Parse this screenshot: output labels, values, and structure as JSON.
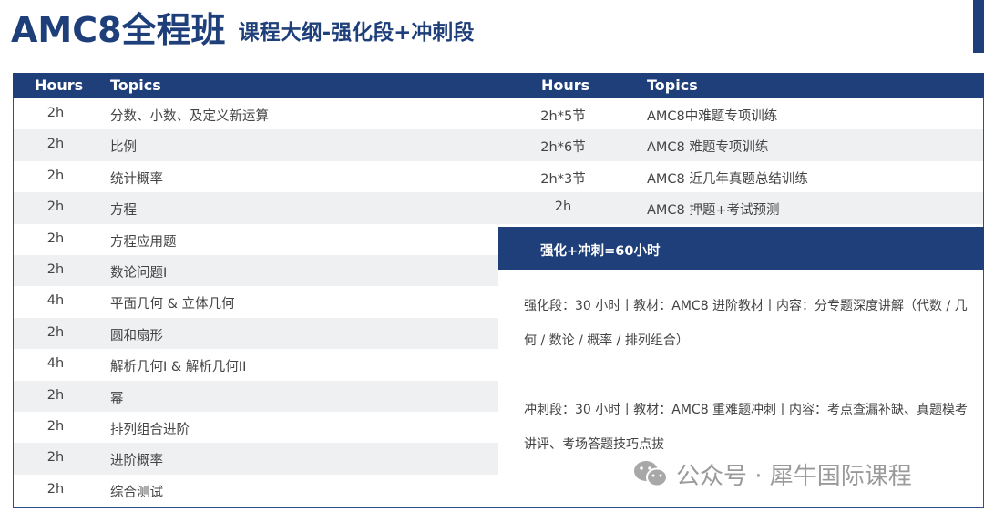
{
  "header": {
    "title": "AMC8全程班",
    "subtitle": "课程大纲-强化段+冲刺段"
  },
  "left_table": {
    "col_hours": "Hours",
    "col_topics": "Topics",
    "rows": [
      {
        "hours": "2h",
        "topic": "分数、小数、及定义新运算"
      },
      {
        "hours": "2h",
        "topic": "比例"
      },
      {
        "hours": "2h",
        "topic": "统计概率"
      },
      {
        "hours": "2h",
        "topic": "方程"
      },
      {
        "hours": "2h",
        "topic": "方程应用题"
      },
      {
        "hours": "2h",
        "topic": "数论问题I"
      },
      {
        "hours": "4h",
        "topic": "平面几何 & 立体几何"
      },
      {
        "hours": "2h",
        "topic": "圆和扇形"
      },
      {
        "hours": "4h",
        "topic": "解析几何I & 解析几何II"
      },
      {
        "hours": "2h",
        "topic": "幂"
      },
      {
        "hours": "2h",
        "topic": "排列组合进阶"
      },
      {
        "hours": "2h",
        "topic": "进阶概率"
      },
      {
        "hours": "2h",
        "topic": "综合测试"
      }
    ]
  },
  "right_table": {
    "col_hours": "Hours",
    "col_topics": "Topics",
    "rows": [
      {
        "hours": "2h*5节",
        "topic": "AMC8中难题专项训练"
      },
      {
        "hours": "2h*6节",
        "topic": "AMC8 难题专项训练"
      },
      {
        "hours": "2h*3节",
        "topic": "AMC8 近几年真题总结训练"
      },
      {
        "hours": "2h",
        "topic": "AMC8 押题+考试预测"
      }
    ]
  },
  "summary": {
    "total": "强化+冲刺=60小时",
    "intensive": "强化段：30 小时丨教材：AMC8 进阶教材丨内容：分专题深度讲解（代数 / 几何 / 数论 / 概率 / 排列组合）",
    "sprint": "冲刺段：30 小时丨教材：AMC8 重难题冲刺丨内容：考点查漏补缺、真题模考讲评、考场答题技巧点拔"
  },
  "watermark": {
    "text": "公众号 · 犀牛国际课程",
    "icon": "wechat-icon"
  },
  "colors": {
    "primary": "#1e3f7a",
    "row_alt": "#eff0f2",
    "text": "#444444"
  }
}
